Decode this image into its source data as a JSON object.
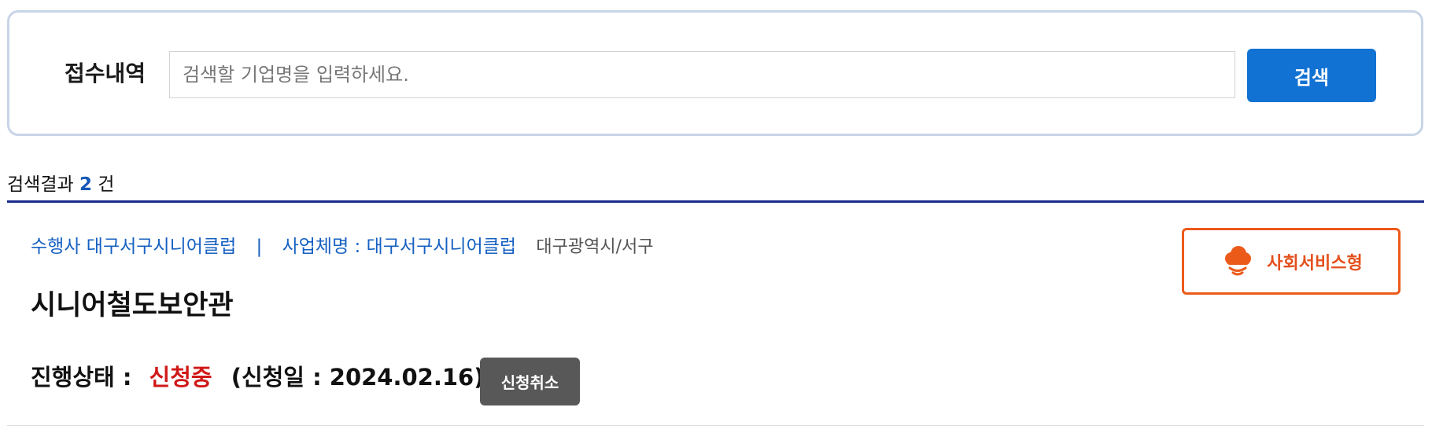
{
  "search": {
    "label": "접수내역",
    "placeholder": "검색할 기업명을 입력하세요.",
    "value": "",
    "button_label": "검색"
  },
  "results": {
    "prefix": "검색결과",
    "count": "2",
    "suffix": "건"
  },
  "item": {
    "operator": "수행사 대구서구시니어클럽",
    "separator": "|",
    "business": "사업체명 : 대구서구시니어클럽",
    "region": "대구광역시/서구",
    "title": "시니어철도보안관",
    "status_label": "진행상태 :",
    "status_value": "신청중",
    "apply_date": "(신청일 : 2024.02.16)",
    "cancel_label": "신청취소",
    "type_label": "사회서비스형",
    "type_icon": "cloud-signal-icon"
  },
  "colors": {
    "primary": "#1272d3",
    "link": "#1660c2",
    "divider": "#1a2a8c",
    "status": "#d01919",
    "badge": "#ec5a1a",
    "cancel": "#585858"
  }
}
